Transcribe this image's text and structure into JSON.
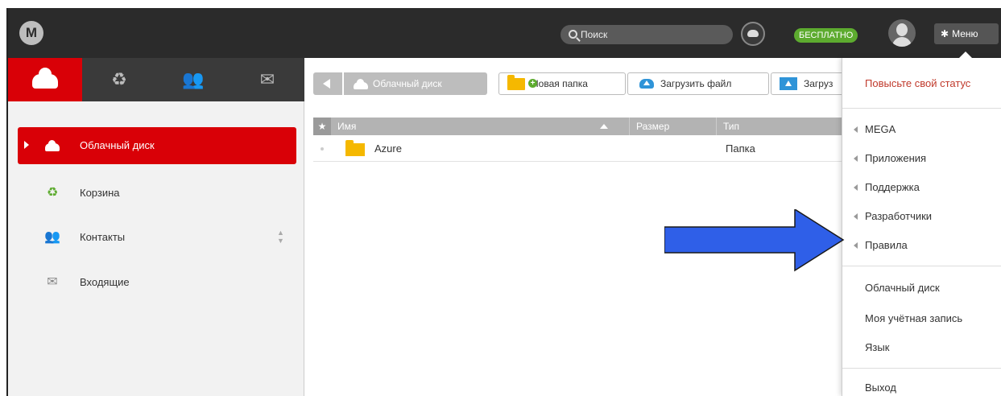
{
  "topbar": {
    "logo": "M",
    "search_placeholder": "Поиск",
    "plan_badge": "БЕСПЛАТНО",
    "menu_label": "Меню",
    "icons": [
      "mega-logo-icon",
      "search-icon",
      "cloud-status-icon",
      "avatar-icon",
      "gear-icon"
    ]
  },
  "iconbar": {
    "tabs": [
      {
        "name": "cloud-drive",
        "icon": "cloud-icon",
        "active": true
      },
      {
        "name": "rubbish-bin",
        "icon": "recycle-icon",
        "active": false
      },
      {
        "name": "contacts",
        "icon": "contacts-icon",
        "active": false
      },
      {
        "name": "inbox",
        "icon": "envelope-icon",
        "active": false
      }
    ]
  },
  "sidebar": {
    "items": [
      {
        "label": "Облачный диск",
        "icon": "cloud-icon",
        "active": true
      },
      {
        "label": "Корзина",
        "icon": "recycle-icon",
        "active": false
      },
      {
        "label": "Контакты",
        "icon": "contacts-icon",
        "active": false
      },
      {
        "label": "Входящие",
        "icon": "envelope-icon",
        "active": false
      }
    ]
  },
  "toolbar": {
    "breadcrumb": "Облачный диск",
    "new_folder": "Новая папка",
    "upload_file": "Загрузить файл",
    "upload_folder": "Загруз"
  },
  "table": {
    "columns": [
      "Имя",
      "Размер",
      "Тип"
    ],
    "rows": [
      {
        "name": "Azure",
        "size": "",
        "type": "Папка"
      }
    ]
  },
  "menu": {
    "upgrade": "Повысьте свой статус",
    "submenus": [
      "MEGA",
      "Приложения",
      "Поддержка",
      "Разработчики",
      "Правила"
    ],
    "links": [
      "Облачный диск",
      "Моя учётная запись",
      "Язык"
    ],
    "logout": "Выход"
  },
  "colors": {
    "brand_red": "#d90007",
    "topbar_bg": "#2b2b2b",
    "plan_green": "#5dab2f",
    "arrow_blue": "#2f5fe8"
  }
}
